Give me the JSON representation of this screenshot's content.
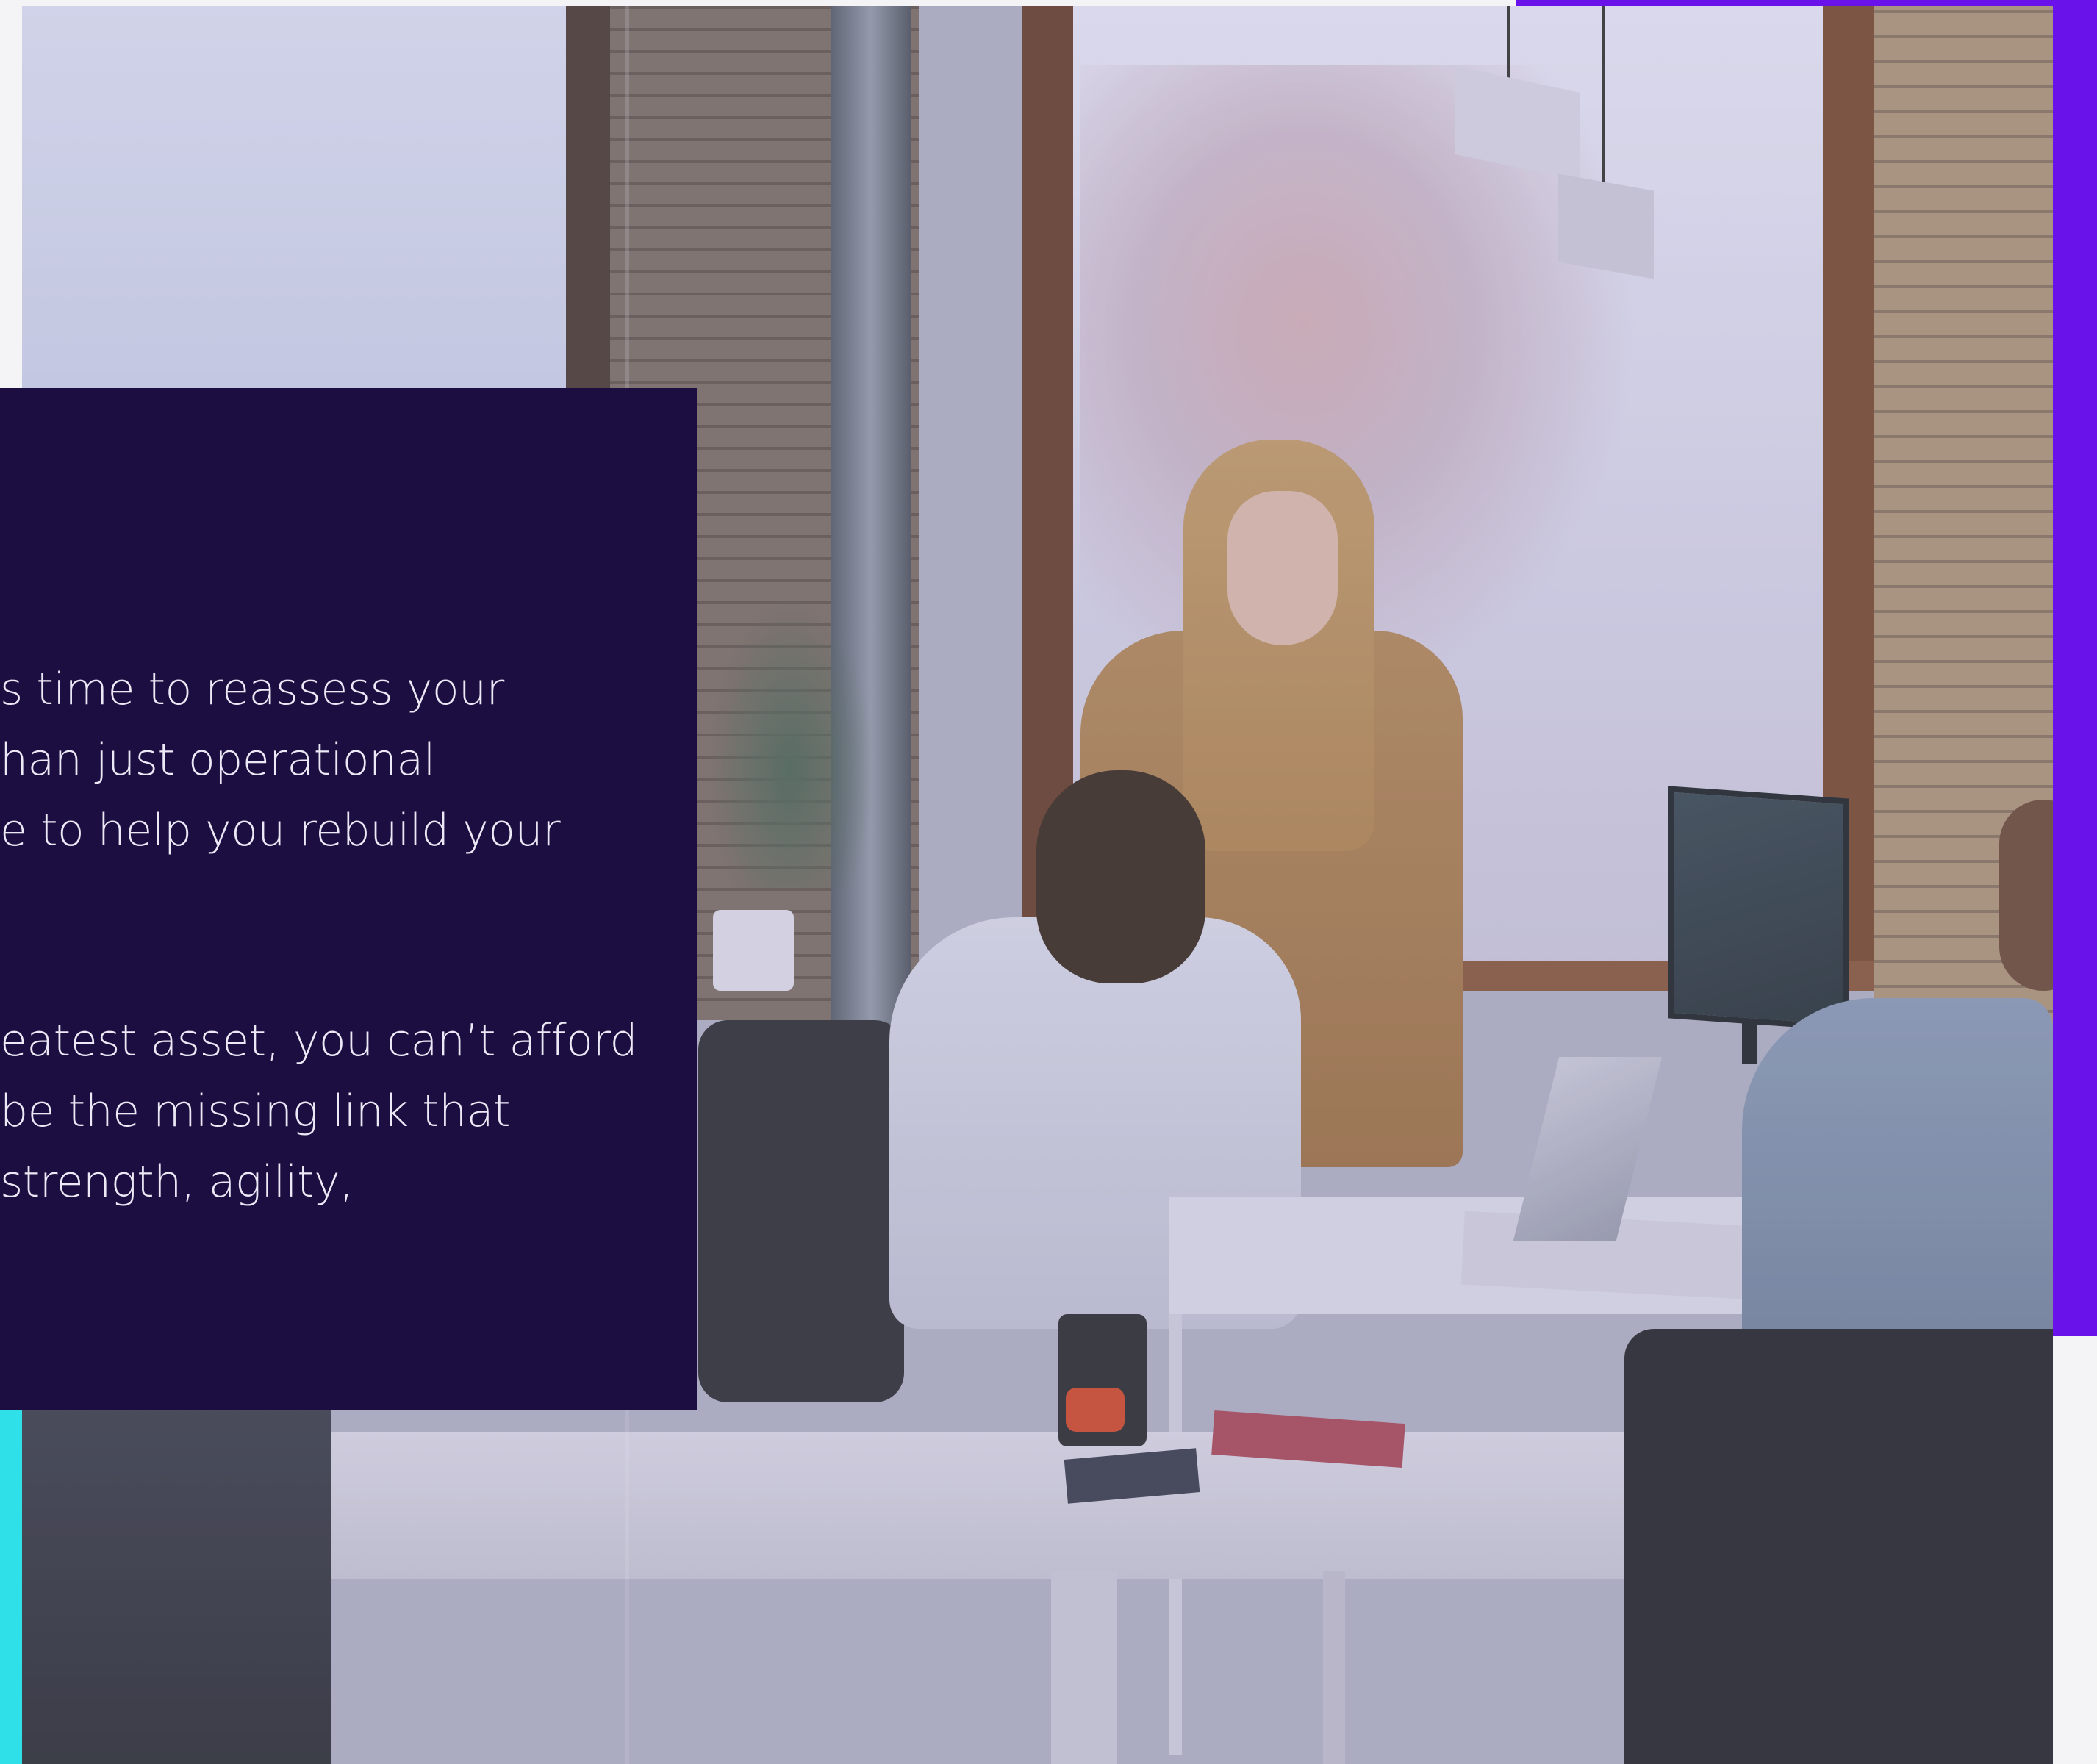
{
  "colors": {
    "panel_background": "#1c0e40",
    "panel_text": "#ece8f6",
    "accent_purple": "#6a12ea",
    "accent_cyan": "#2fe0e8"
  },
  "hero": {
    "image_name": "office-team-photo"
  },
  "panel": {
    "paragraph_1": {
      "lines": [
        "s time to reassess your",
        "han just operational",
        "e to help you rebuild your"
      ]
    },
    "paragraph_2": {
      "lines": [
        "eatest asset, you can’t afford",
        "be the missing link that",
        " strength, agility,"
      ]
    }
  }
}
